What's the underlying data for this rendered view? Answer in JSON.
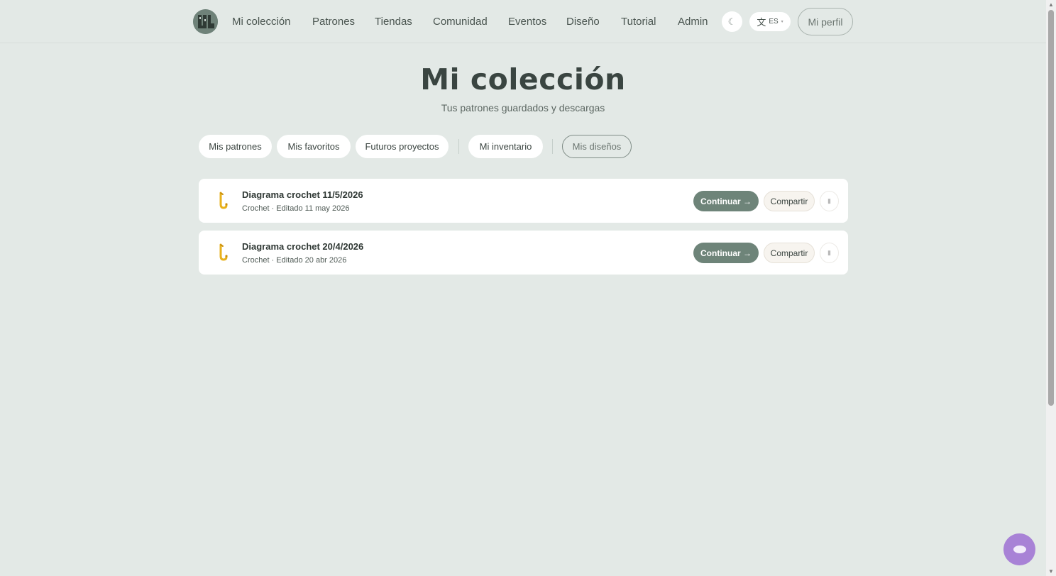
{
  "nav": {
    "items": [
      {
        "label": "Mi colección"
      },
      {
        "label": "Patrones"
      },
      {
        "label": "Tiendas"
      },
      {
        "label": "Comunidad"
      },
      {
        "label": "Eventos"
      },
      {
        "label": "Diseño"
      },
      {
        "label": "Tutorial"
      },
      {
        "label": "Admin"
      }
    ],
    "theme_icon": "☾",
    "language": {
      "glyph": "文",
      "code": "ES",
      "caret": "▾"
    },
    "profile_label": "Mi perfil"
  },
  "header": {
    "title": "Mi colección",
    "subtitle": "Tus patrones guardados y descargas"
  },
  "tabs": [
    {
      "label": "Mis patrones",
      "active": false
    },
    {
      "label": "Mis favoritos",
      "active": false
    },
    {
      "label": "Futuros proyectos",
      "active": false
    },
    {
      "label": "Mi inventario",
      "active": false
    },
    {
      "label": "Mis diseños",
      "active": true
    }
  ],
  "designs": [
    {
      "title": "Diagrama crochet 11/5/2026",
      "meta": "Crochet · Editado 11 may 2026",
      "continue_label": "Continuar →",
      "share_label": "Compartir",
      "icon": "crochet-hook-icon"
    },
    {
      "title": "Diagrama crochet 20/4/2026",
      "meta": "Crochet · Editado 20 abr 2026",
      "continue_label": "Continuar →",
      "share_label": "Compartir",
      "icon": "crochet-hook-icon"
    }
  ],
  "colors": {
    "background": "#e3e9e6",
    "accent": "#6e8479",
    "chat": "#a882d6",
    "hook": "#e8b11c"
  }
}
